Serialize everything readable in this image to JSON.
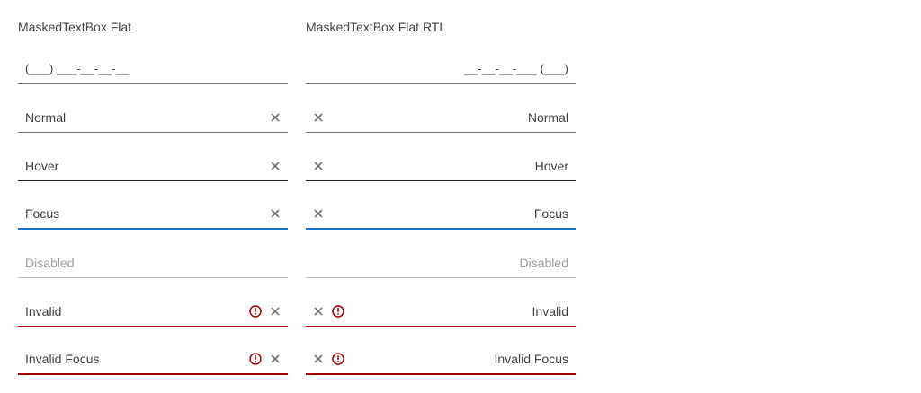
{
  "columns": {
    "ltr": {
      "title": "MaskedTextBox Flat",
      "mask": "(___) ___-__-__-__",
      "fields": {
        "normal": "Normal",
        "hover": "Hover",
        "focus": "Focus",
        "disabled": "Disabled",
        "invalid": "Invalid",
        "invalid_focus": "Invalid Focus"
      }
    },
    "rtl": {
      "title": "MaskedTextBox Flat RTL",
      "mask": "__-__-__-___ (___)",
      "fields": {
        "normal": "Normal",
        "hover": "Hover",
        "focus": "Focus",
        "disabled": "Disabled",
        "invalid": "Invalid",
        "invalid_focus": "Invalid Focus"
      }
    }
  },
  "icons": {
    "clear": "close-icon",
    "error": "exclamation-circle-icon"
  },
  "colors": {
    "text": "#424242",
    "border": "#6f6f6f",
    "focus": "#1a73c8",
    "invalid": "#a50000",
    "disabled": "#9e9e9e"
  }
}
